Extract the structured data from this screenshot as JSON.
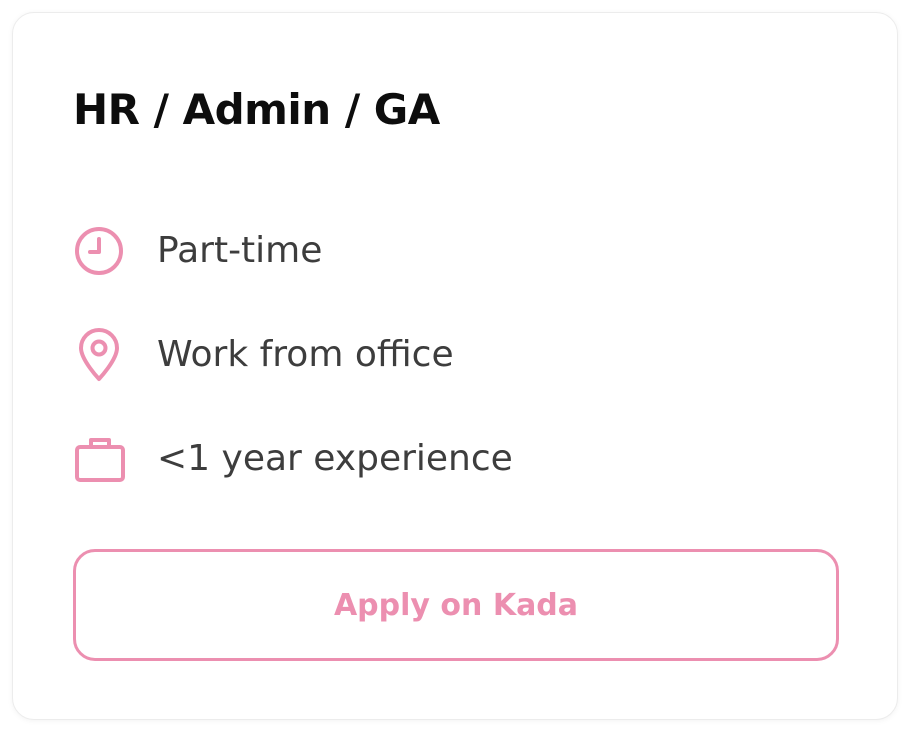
{
  "job": {
    "title": "HR / Admin / GA"
  },
  "details": [
    {
      "icon": "clock-icon",
      "label": "Part-time"
    },
    {
      "icon": "location-pin-icon",
      "label": "Work from office"
    },
    {
      "icon": "briefcase-icon",
      "label": "<1 year experience"
    }
  ],
  "apply_button": {
    "label": "Apply on Kada"
  },
  "colors": {
    "accent": "#ec8fb0",
    "title": "#0d0d0d",
    "text": "#3d3d3d",
    "card_border": "#ececec"
  }
}
